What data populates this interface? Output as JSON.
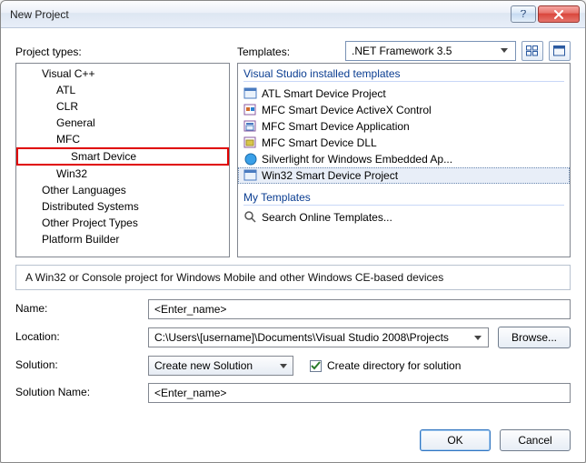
{
  "window": {
    "title": "New Project"
  },
  "labels": {
    "project_types": "Project types:",
    "templates": "Templates:",
    "name": "Name:",
    "location": "Location:",
    "solution": "Solution:",
    "solution_name": "Solution Name:",
    "create_dir": "Create directory for solution",
    "browse": "Browse...",
    "ok": "OK",
    "cancel": "Cancel"
  },
  "framework": {
    "selected": ".NET Framework 3.5"
  },
  "tree": {
    "root": "Visual C++",
    "children": [
      "ATL",
      "CLR",
      "General",
      "MFC",
      "Smart Device",
      "Win32"
    ],
    "siblings": [
      "Other Languages",
      "Distributed Systems",
      "Other Project Types",
      "Platform Builder"
    ]
  },
  "templates": {
    "installed_header": "Visual Studio installed templates",
    "items": [
      "ATL Smart Device Project",
      "MFC Smart Device ActiveX Control",
      "MFC Smart Device Application",
      "MFC Smart Device DLL",
      "Silverlight for Windows Embedded Ap...",
      "Win32 Smart Device Project"
    ],
    "my_header": "My Templates",
    "my_items": [
      "Search Online Templates..."
    ]
  },
  "description": "A Win32 or Console project for Windows Mobile and other Windows CE-based devices",
  "form": {
    "name_value": "<Enter_name>",
    "location_value": "C:\\Users\\[username]\\Documents\\Visual Studio 2008\\Projects",
    "solution_value": "Create new Solution",
    "solution_name_value": "<Enter_name>",
    "create_dir_checked": true
  }
}
